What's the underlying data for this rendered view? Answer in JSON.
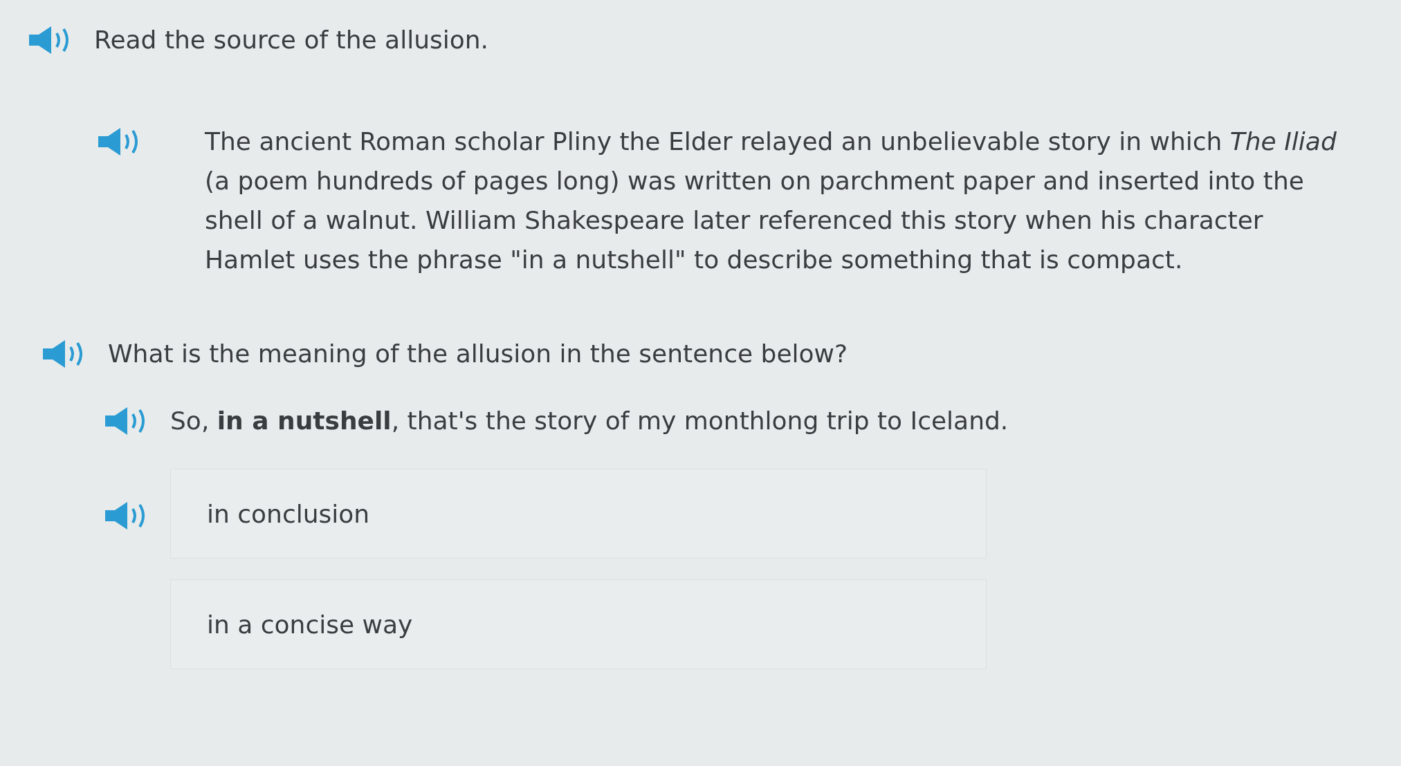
{
  "prompt": "Read the source of the allusion.",
  "passage": "The ancient Roman scholar Pliny the Elder relayed an unbelievable story in which *The Iliad* (a poem hundreds of pages long) was written on parchment paper and inserted into the shell of a walnut. William Shakespeare later referenced this story when his character Hamlet uses the phrase \"in a nutshell\" to describe something that is compact.",
  "question": "What is the meaning of the allusion in the sentence below?",
  "sentence": "So, **in a nutshell**, that's the story of my monthlong trip to Iceland.",
  "choices": [
    {
      "label": "in conclusion",
      "audio": true
    },
    {
      "label": "in a concise way",
      "audio": false
    }
  ]
}
